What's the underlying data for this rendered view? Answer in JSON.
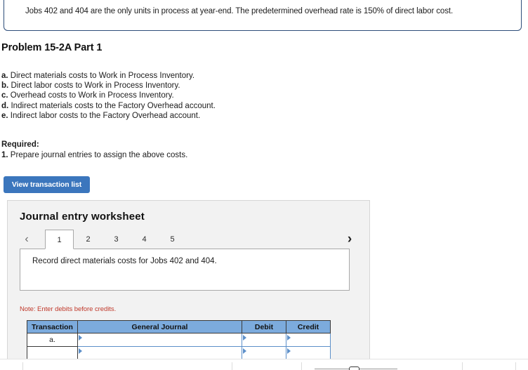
{
  "info_banner": {
    "text": "Jobs 402 and 404 are the only units in process at year-end. The predetermined overhead rate is 150% of direct labor cost.",
    "border_color": "#2d4d7a"
  },
  "problem": {
    "title": "Problem 15-2A Part 1",
    "cost_items": [
      {
        "letter": "a.",
        "text": "Direct materials costs to Work in Process Inventory."
      },
      {
        "letter": "b.",
        "text": "Direct labor costs to Work in Process Inventory."
      },
      {
        "letter": "c.",
        "text": "Overhead costs to Work in Process Inventory."
      },
      {
        "letter": "d.",
        "text": "Indirect materials costs to the Factory Overhead account."
      },
      {
        "letter": "e.",
        "text": "Indirect labor costs to the Factory Overhead account."
      }
    ],
    "required_heading": "Required:",
    "required_number": "1.",
    "required_text": "Prepare journal entries to assign the above costs."
  },
  "actions": {
    "view_transaction_list": "View transaction list",
    "button_color": "#3b76bd"
  },
  "worksheet": {
    "title": "Journal entry worksheet",
    "prev_icon": "chevron-left-icon",
    "next_icon": "chevron-right-icon",
    "tabs": [
      {
        "label": "1",
        "active": true
      },
      {
        "label": "2",
        "active": false
      },
      {
        "label": "3",
        "active": false
      },
      {
        "label": "4",
        "active": false
      },
      {
        "label": "5",
        "active": false
      }
    ],
    "description": "Record direct materials costs for Jobs 402 and 404.",
    "note": "Note: Enter debits before credits.",
    "note_color": "#c0392b",
    "table": {
      "header_color": "#7cabdd",
      "columns": [
        "Transaction",
        "General Journal",
        "Debit",
        "Credit"
      ],
      "rows": [
        {
          "transaction": "a.",
          "general_journal": "",
          "debit": "",
          "credit": ""
        },
        {
          "transaction": "",
          "general_journal": "",
          "debit": "",
          "credit": ""
        }
      ]
    }
  },
  "bottom_toolbar": {
    "zoom_slider": "zoom-slider"
  }
}
